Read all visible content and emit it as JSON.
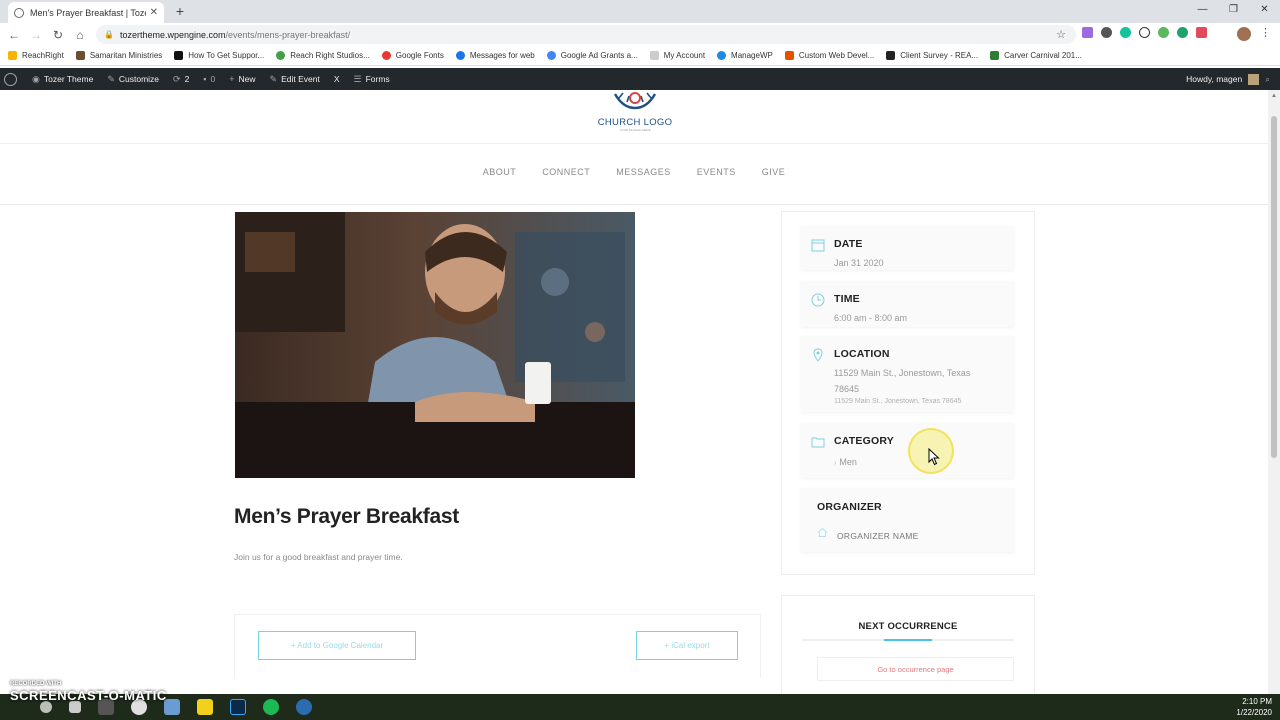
{
  "browser": {
    "tab_title": "Men's Prayer Breakfast | Tozer Th",
    "tab_close": "✕",
    "new_tab": "+",
    "url_host": "tozertheme.wpengine.com",
    "url_path": "/events/mens-prayer-breakfast/",
    "window_controls": [
      "—",
      "❐",
      "✕"
    ]
  },
  "bookmarks": [
    {
      "label": "ReachRight",
      "color": "#f4b400"
    },
    {
      "label": "Samaritan Ministries",
      "color": "#6b4e2e"
    },
    {
      "label": "How To Get Suppor...",
      "color": "#111111"
    },
    {
      "label": "Reach Right Studios...",
      "color": "#43a047"
    },
    {
      "label": "Google Fonts",
      "color": "#e53935"
    },
    {
      "label": "Messages for web",
      "color": "#1a73e8"
    },
    {
      "label": "Google Ad Grants a...",
      "color": "#4285f4"
    },
    {
      "label": "My Account",
      "color": "#cccccc"
    },
    {
      "label": "ManageWP",
      "color": "#1e88e5"
    },
    {
      "label": "Custom Web Devel...",
      "color": "#e65100"
    },
    {
      "label": "Client Survey - REA...",
      "color": "#222222"
    },
    {
      "label": "Carver Carnival 201...",
      "color": "#2e7d32"
    }
  ],
  "wp_bar": {
    "site_name": "Tozer Theme",
    "customize": "Customize",
    "updates": "2",
    "comments": "0",
    "new": "New",
    "edit": "Edit Event",
    "x": "X",
    "forms": "Forms",
    "howdy": "Howdy, magen"
  },
  "site": {
    "logo_name": "CHURCH LOGO",
    "logo_slogan": "YOUR SLOGAN HERE",
    "menu": [
      "ABOUT",
      "CONNECT",
      "MESSAGES",
      "EVENTS",
      "GIVE"
    ]
  },
  "event": {
    "title": "Men’s Prayer Breakfast",
    "description": "Join us for a good breakfast and prayer time.",
    "google_cal": "+ Add to Google Calendar",
    "ical": "+ iCal export"
  },
  "details": {
    "date_label": "DATE",
    "date_value": "Jan 31 2020",
    "time_label": "TIME",
    "time_value": "6:00 am - 8:00 am",
    "location_label": "LOCATION",
    "location_line1": "11529 Main St., Jonestown, Texas",
    "location_line2": "78645",
    "location_sub": "11529 Main St., Jonestown, Texas 78645",
    "category_label": "CATEGORY",
    "category_value": "Men",
    "organizer_label": "ORGANIZER",
    "organizer_value": "ORGANIZER NAME"
  },
  "next": {
    "title": "NEXT OCCURRENCE",
    "button": "Go to occurrence page"
  },
  "taskbar": {
    "time": "2:10 PM",
    "date": "1/22/2020",
    "watermark_small": "RECORDED WITH",
    "watermark_big": "SCREENCAST-O-MATIC"
  },
  "colors": {
    "accent": "#49c5e0",
    "wp_bar": "#23282d",
    "logo_blue": "#1d5185"
  }
}
